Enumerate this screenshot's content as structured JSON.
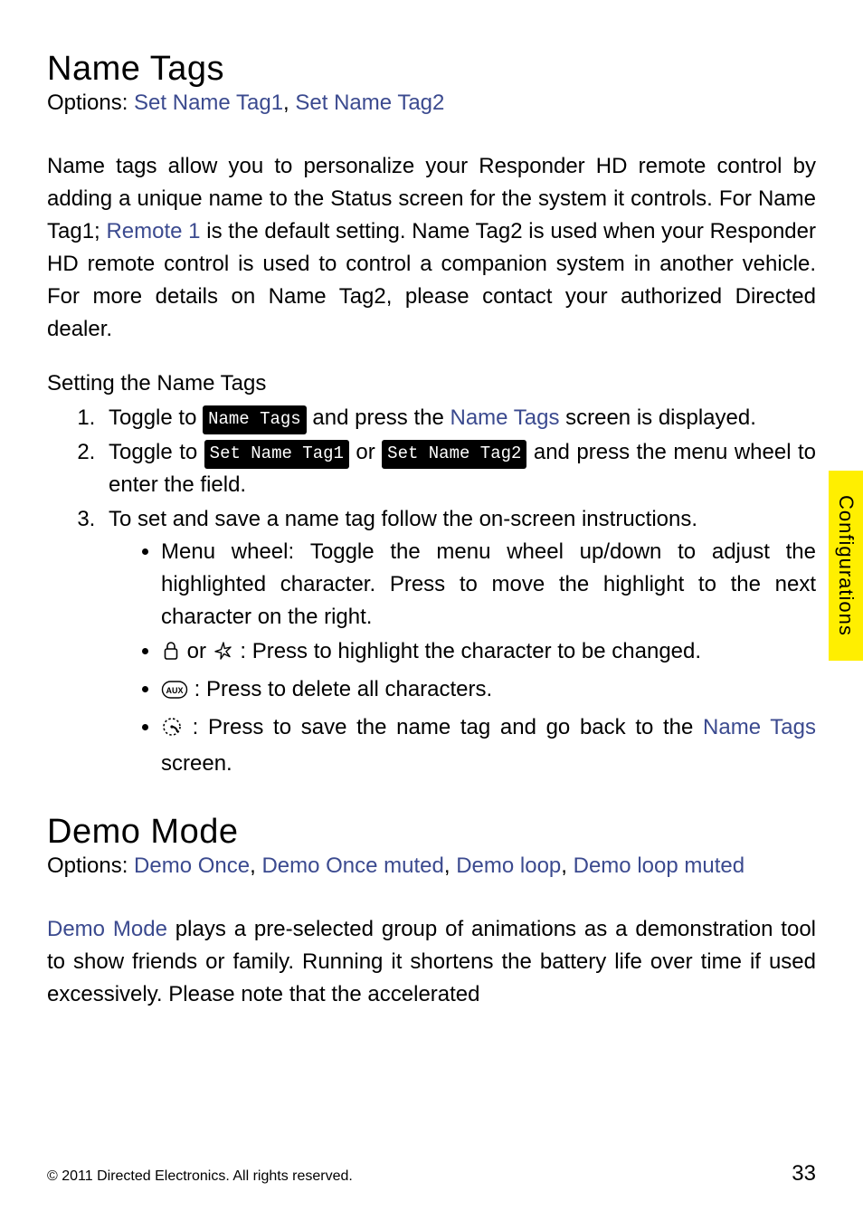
{
  "sideTab": "Configurations",
  "section1": {
    "title": "Name Tags",
    "optionsLabel": "Options: ",
    "option1": "Set Name Tag1",
    "optionSep": ", ",
    "option2": "Set Name Tag2",
    "para_a": "Name tags allow you to personalize your Responder HD remote control by adding a unique name to the Status screen for the system it controls. For Name Tag1; ",
    "para_hl": "Remote 1",
    "para_b": " is the default setting. Name Tag2 is used when your Responder HD remote control is used to control a companion system in another vehicle.  For more details on Name Tag2, please contact your authorized Directed dealer.",
    "subheading": "Setting the Name Tags",
    "step1": {
      "toggle": "Toggle",
      "to": " to ",
      "chip": "Name Tags",
      "and": " and ",
      "press": "press",
      "the": " the ",
      "hl": "Name Tags",
      "rest": " screen is displayed."
    },
    "step2": {
      "toggle": "Toggle",
      "to": " to ",
      "chip1": "Set Name Tag1",
      "or": " or ",
      "chip2": "Set Name Tag2",
      "and": " and ",
      "press": "press",
      "rest": " the menu wheel to enter the field."
    },
    "step3": {
      "text": "To set and save a name tag follow the on-screen instructions.",
      "b1a": "Menu wheel: ",
      "b1toggle": "Toggle",
      "b1b": " the menu wheel up/down to adjust the highlighted character. ",
      "b1press": "Press",
      "b1c": " to move the highlight to the next character on the right.",
      "b2or": "or",
      "b2colon": " : ",
      "b2press": "Press",
      "b2rest": " to highlight the character to be changed.",
      "b3colon": " : ",
      "b3press": "Press",
      "b3rest": " to delete all characters.",
      "b4colon": " : ",
      "b4press": "Press",
      "b4a": " to save the name tag and go back to the ",
      "b4hl": "Name Tags",
      "b4b": " screen."
    }
  },
  "section2": {
    "title": "Demo Mode",
    "optionsLabel": "Options: ",
    "opt1": "Demo Once",
    "sep": ",  ",
    "opt2": "Demo Once muted",
    "sep2": ", ",
    "opt3": "Demo loop",
    "opt4": "Demo loop muted",
    "para_hl": "Demo Mode",
    "para_rest": " plays a pre-selected group of animations as a demonstration tool to show friends or family. Running it shortens the battery life over time if used excessively. Please note that the accelerated"
  },
  "footer": {
    "copyright": "© 2011 Directed Electronics. All rights reserved.",
    "page": "33"
  }
}
